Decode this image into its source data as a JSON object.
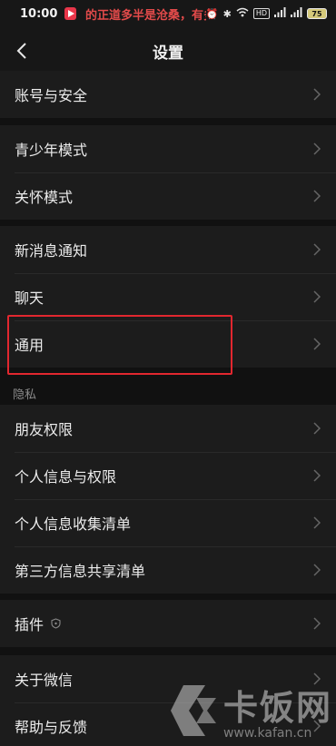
{
  "status_bar": {
    "time": "10:00",
    "marquee": "的正道多半是沧桑，有多少难苦",
    "battery": "75",
    "hd": "HD"
  },
  "header": {
    "title": "设置"
  },
  "groups": {
    "account": [
      {
        "label": "账号与安全"
      }
    ],
    "modes": [
      {
        "label": "青少年模式"
      },
      {
        "label": "关怀模式"
      }
    ],
    "general": [
      {
        "label": "新消息通知"
      },
      {
        "label": "聊天"
      },
      {
        "label": "通用"
      }
    ],
    "privacy_title": "隐私",
    "privacy": [
      {
        "label": "朋友权限"
      },
      {
        "label": "个人信息与权限"
      },
      {
        "label": "个人信息收集清单"
      },
      {
        "label": "第三方信息共享清单"
      }
    ],
    "plugins": [
      {
        "label": "插件"
      }
    ],
    "about": [
      {
        "label": "关于微信"
      },
      {
        "label": "帮助与反馈"
      }
    ]
  },
  "watermark": {
    "brand": "卡饭网",
    "url": "www.kafan.cn"
  },
  "colors": {
    "highlight": "#e2272f",
    "background": "#111111",
    "row": "#1c1c1c"
  }
}
